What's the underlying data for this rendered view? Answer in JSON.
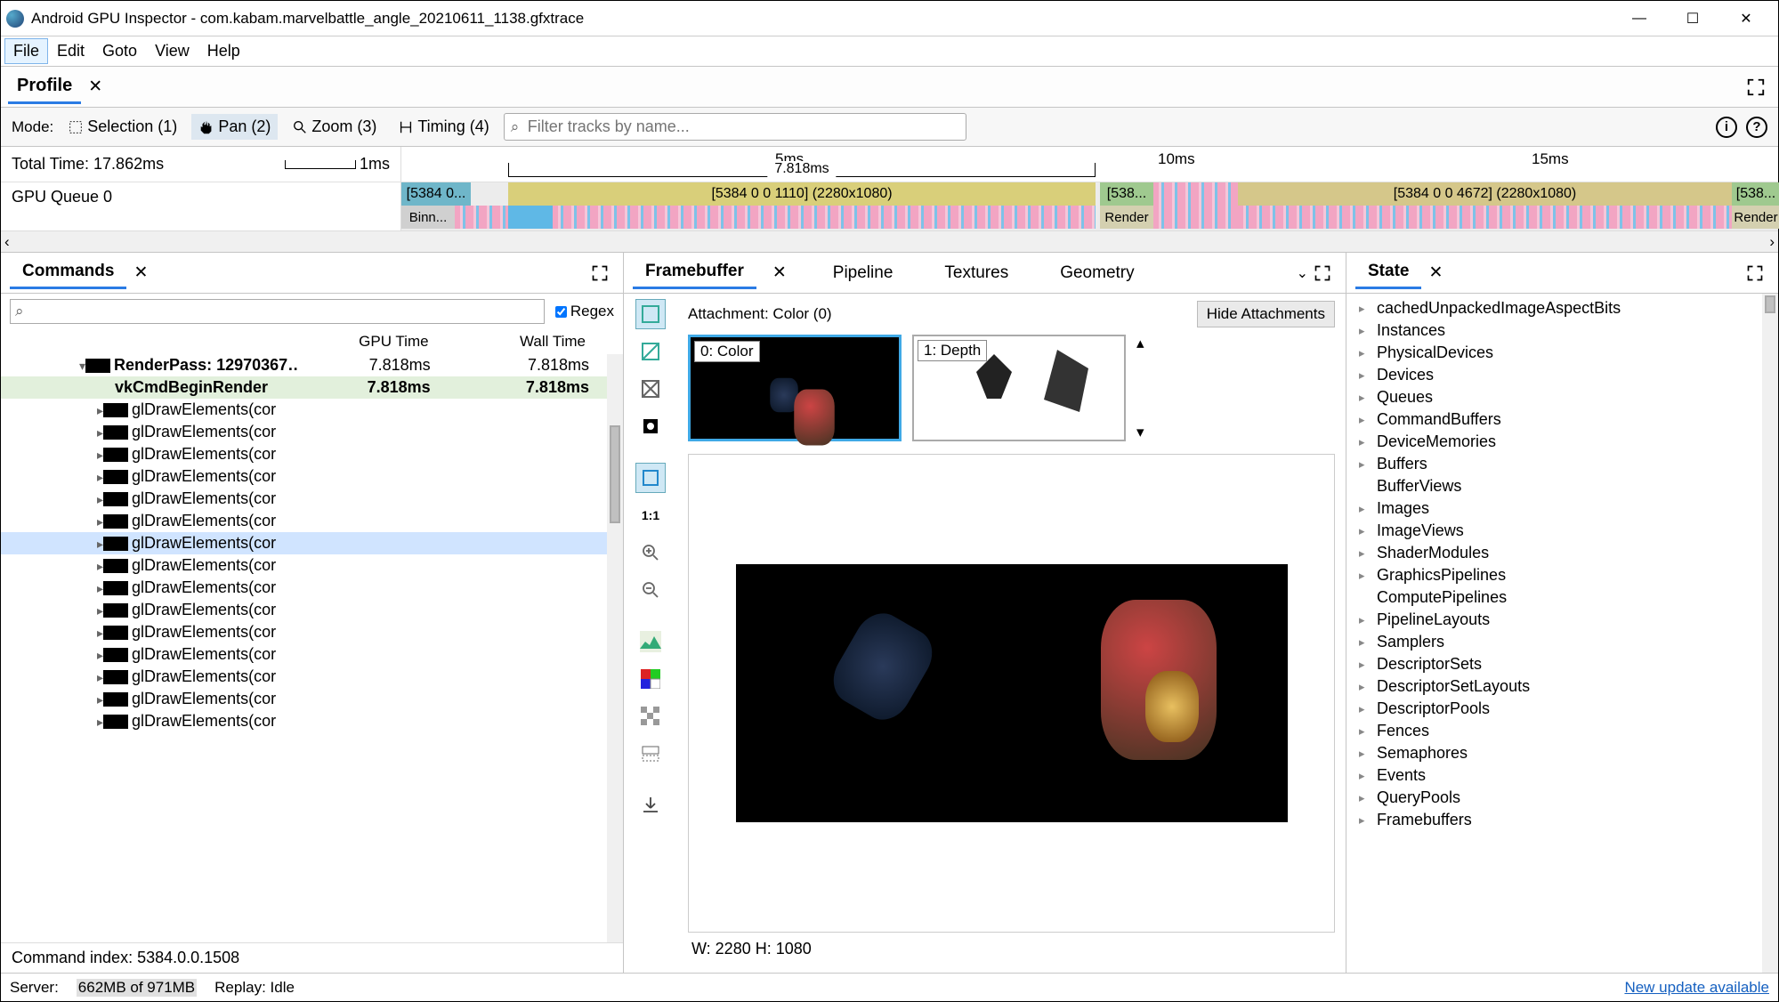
{
  "app_title": "Android GPU Inspector - com.kabam.marvelbattle_angle_20210611_1138.gfxtrace",
  "menus": [
    "File",
    "Edit",
    "Goto",
    "View",
    "Help"
  ],
  "profile_tab": "Profile",
  "mode_label": "Mode:",
  "modes": [
    "Selection (1)",
    "Pan (2)",
    "Zoom (3)",
    "Timing (4)"
  ],
  "filter_placeholder": "Filter tracks by name...",
  "total_time_label": "Total Time: 17.862ms",
  "scale_hint": "1ms",
  "ticks": [
    "5ms",
    "10ms",
    "15ms"
  ],
  "bracket_label": "7.818ms",
  "gpu_queue": "GPU Queue 0",
  "seg_a": "[5384 0...",
  "seg_a2": "Binn...",
  "seg_b": "[5384 0 0 1110] (2280x1080)",
  "seg_c": "[538...",
  "seg_c2": "Render",
  "seg_d": "[5384 0 0 4672] (2280x1080)",
  "seg_e": "[538...",
  "seg_e2": "Render",
  "panes": {
    "commands": "Commands",
    "framebuffer": "Framebuffer",
    "pipeline": "Pipeline",
    "textures": "Textures",
    "geometry": "Geometry",
    "state": "State"
  },
  "regex_label": "Regex",
  "cmd_cols": [
    "",
    "GPU Time",
    "Wall Time"
  ],
  "cmd_rows": [
    {
      "indent": 80,
      "arrow": "▾",
      "bold": true,
      "chip": true,
      "text": "RenderPass: 12970367…",
      "gpu": "7.818ms",
      "wall": "7.818ms"
    },
    {
      "indent": 120,
      "arrow": "",
      "bold": true,
      "hl": true,
      "chip": false,
      "text": "vkCmdBeginRender",
      "gpu": "7.818ms",
      "wall": "7.818ms"
    },
    {
      "indent": 100,
      "arrow": "▸",
      "chip": true,
      "text": "glDrawElements(cor",
      "gpu": "",
      "wall": ""
    },
    {
      "indent": 100,
      "arrow": "▸",
      "chip": true,
      "text": "glDrawElements(cor",
      "gpu": "",
      "wall": ""
    },
    {
      "indent": 100,
      "arrow": "▸",
      "chip": true,
      "text": "glDrawElements(cor",
      "gpu": "",
      "wall": ""
    },
    {
      "indent": 100,
      "arrow": "▸",
      "chip": true,
      "text": "glDrawElements(cor",
      "gpu": "",
      "wall": ""
    },
    {
      "indent": 100,
      "arrow": "▸",
      "chip": true,
      "text": "glDrawElements(cor",
      "gpu": "",
      "wall": ""
    },
    {
      "indent": 100,
      "arrow": "▸",
      "chip": true,
      "text": "glDrawElements(cor",
      "gpu": "",
      "wall": ""
    },
    {
      "indent": 100,
      "arrow": "▸",
      "chip": true,
      "sel": true,
      "text": "glDrawElements(cor",
      "gpu": "",
      "wall": ""
    },
    {
      "indent": 100,
      "arrow": "▸",
      "chip": true,
      "text": "glDrawElements(cor",
      "gpu": "",
      "wall": ""
    },
    {
      "indent": 100,
      "arrow": "▸",
      "chip": true,
      "text": "glDrawElements(cor",
      "gpu": "",
      "wall": ""
    },
    {
      "indent": 100,
      "arrow": "▸",
      "chip": true,
      "text": "glDrawElements(cor",
      "gpu": "",
      "wall": ""
    },
    {
      "indent": 100,
      "arrow": "▸",
      "chip": true,
      "text": "glDrawElements(cor",
      "gpu": "",
      "wall": ""
    },
    {
      "indent": 100,
      "arrow": "▸",
      "chip": true,
      "text": "glDrawElements(cor",
      "gpu": "",
      "wall": ""
    },
    {
      "indent": 100,
      "arrow": "▸",
      "chip": true,
      "text": "glDrawElements(cor",
      "gpu": "",
      "wall": ""
    },
    {
      "indent": 100,
      "arrow": "▸",
      "chip": true,
      "text": "glDrawElements(cor",
      "gpu": "",
      "wall": ""
    },
    {
      "indent": 100,
      "arrow": "▸",
      "chip": true,
      "text": "glDrawElements(cor",
      "gpu": "",
      "wall": ""
    }
  ],
  "cmd_index": "Command index: 5384.0.0.1508",
  "attachment_label": "Attachment: Color (0)",
  "hide_att": "Hide Attachments",
  "thumb_color": "0: Color",
  "thumb_depth": "1: Depth",
  "fb_size": "W: 2280 H: 1080",
  "state_items": [
    {
      "a": "▸",
      "t": "cachedUnpackedImageAspectBits"
    },
    {
      "a": "▸",
      "t": "Instances"
    },
    {
      "a": "▸",
      "t": "PhysicalDevices"
    },
    {
      "a": "▸",
      "t": "Devices"
    },
    {
      "a": "▸",
      "t": "Queues"
    },
    {
      "a": "▸",
      "t": "CommandBuffers"
    },
    {
      "a": "▸",
      "t": "DeviceMemories"
    },
    {
      "a": "▸",
      "t": "Buffers"
    },
    {
      "a": "",
      "t": "BufferViews"
    },
    {
      "a": "▸",
      "t": "Images"
    },
    {
      "a": "▸",
      "t": "ImageViews"
    },
    {
      "a": "▸",
      "t": "ShaderModules"
    },
    {
      "a": "▸",
      "t": "GraphicsPipelines"
    },
    {
      "a": "",
      "t": "ComputePipelines"
    },
    {
      "a": "▸",
      "t": "PipelineLayouts"
    },
    {
      "a": "▸",
      "t": "Samplers"
    },
    {
      "a": "▸",
      "t": "DescriptorSets"
    },
    {
      "a": "▸",
      "t": "DescriptorSetLayouts"
    },
    {
      "a": "▸",
      "t": "DescriptorPools"
    },
    {
      "a": "▸",
      "t": "Fences"
    },
    {
      "a": "▸",
      "t": "Semaphores"
    },
    {
      "a": "▸",
      "t": "Events"
    },
    {
      "a": "▸",
      "t": "QueryPools"
    },
    {
      "a": "▸",
      "t": "Framebuffers"
    }
  ],
  "server_label": "Server:",
  "server_mem": "662MB of 971MB",
  "replay": "Replay: Idle",
  "update": "New update available"
}
